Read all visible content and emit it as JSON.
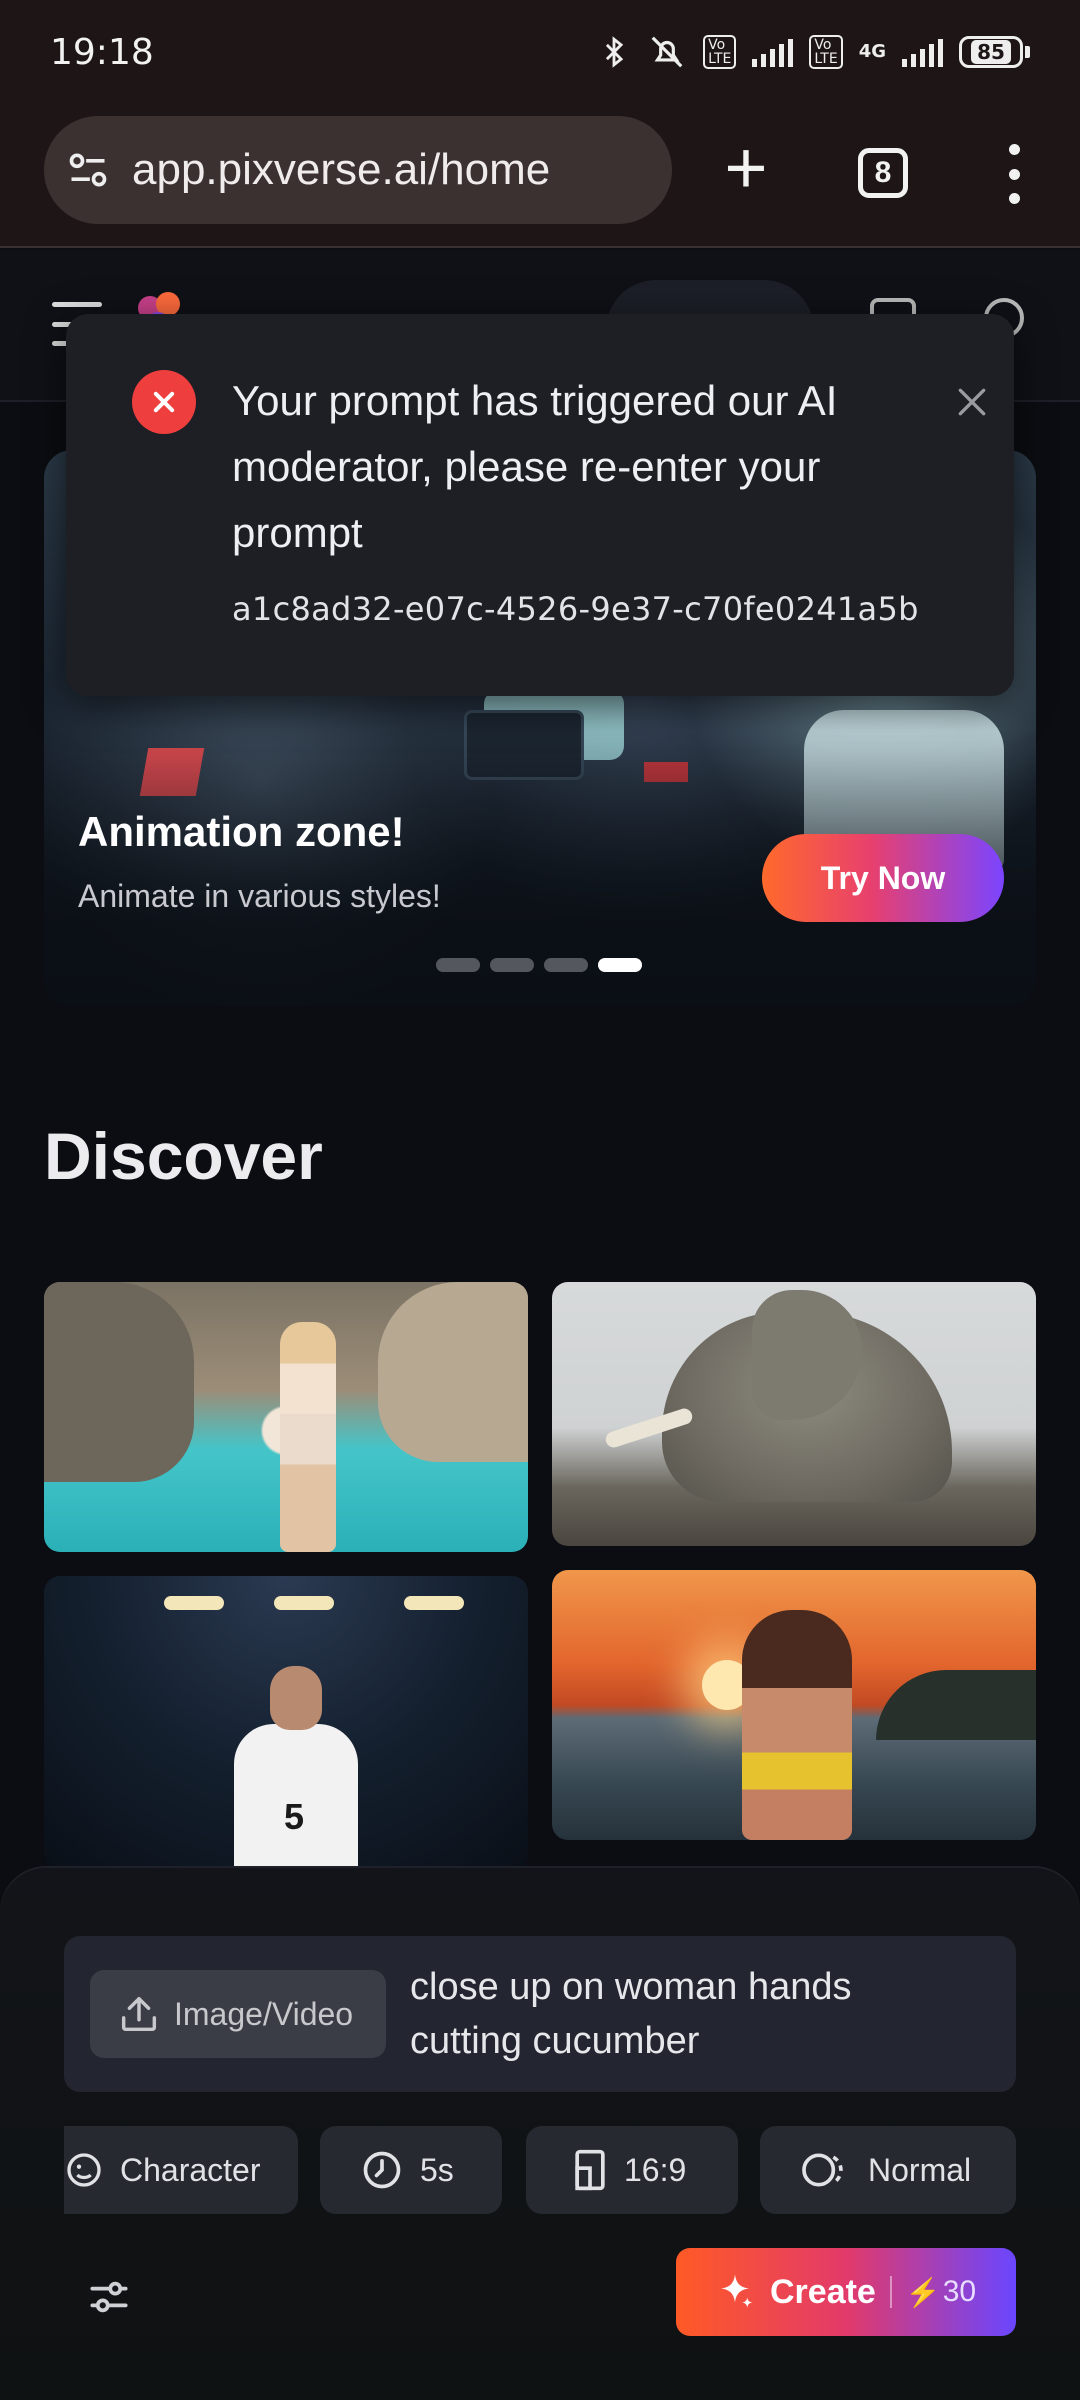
{
  "status_bar": {
    "time": "19:18",
    "battery": "85",
    "network": "4G"
  },
  "browser": {
    "url": "app.pixverse.ai/home",
    "tab_count": "8"
  },
  "banner": {
    "title": "Animation zone!",
    "subtitle": "Animate in various styles!",
    "button": "Try Now",
    "slide_count": 4,
    "active_slide": 4
  },
  "toast": {
    "message": "Your prompt has triggered our AI moderator, please re-enter your prompt",
    "code": "a1c8ad32-e07c-4526-9e37-c70fe0241a5b",
    "accent_color": "#ee3e3e"
  },
  "discover": {
    "title": "Discover",
    "items": [
      {
        "icon": "woman-in-lagoon-image"
      },
      {
        "icon": "stone-elephant-image"
      },
      {
        "icon": "soccer-player-image"
      },
      {
        "icon": "woman-at-sunset-image"
      }
    ]
  },
  "composer": {
    "upload_label": "Image/Video",
    "prompt_text": "close up on woman hands cutting cucumber",
    "chips": {
      "character": "Character",
      "duration": "5s",
      "ratio": "16:9",
      "mode": "Normal"
    },
    "create_label": "Create",
    "create_cost": "30"
  },
  "colors": {
    "accent_gradient_start": "#ff5a26",
    "accent_gradient_end": "#6a46ff",
    "credit_bolt": "#ffd23a"
  }
}
